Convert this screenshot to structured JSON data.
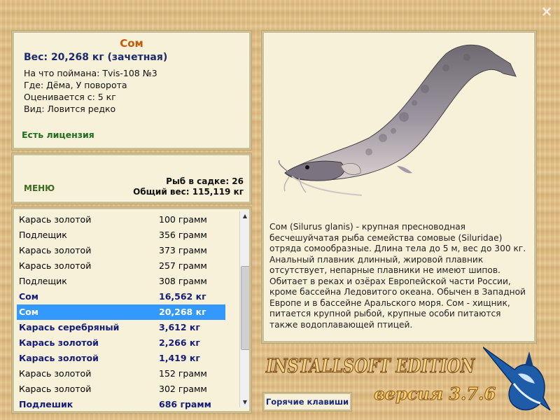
{
  "window": {
    "close_glyph": "×"
  },
  "catch_info": {
    "fish_name": "Сом",
    "weight": "Вес: 20,268 кг (зачетная)",
    "caught_on": "На что поймана: Tvis-108 №3",
    "where": "Где: Дёма, У поворота",
    "rated_from": "Оценивается с: 5 кг",
    "species_status": "Вид: Ловится редко",
    "license": "Есть лицензия"
  },
  "stats": {
    "menu_label": "МЕНЮ",
    "fish_count": "Рыб в садке: 26",
    "total_weight": "Общий вес: 115,119 кг"
  },
  "catch_list": [
    {
      "name": "Карась золотой",
      "weight": "100 грамм",
      "style": "normal"
    },
    {
      "name": "Подлещик",
      "weight": "356 грамм",
      "style": "normal"
    },
    {
      "name": "Карась золотой",
      "weight": "373 грамм",
      "style": "normal"
    },
    {
      "name": "Карась золотой",
      "weight": "257 грамм",
      "style": "normal"
    },
    {
      "name": "Подлещик",
      "weight": "308 грамм",
      "style": "normal"
    },
    {
      "name": "Сом",
      "weight": "16,562 кг",
      "style": "bold"
    },
    {
      "name": "Сом",
      "weight": "20,268 кг",
      "style": "selected"
    },
    {
      "name": "Карась серебряный",
      "weight": "3,612 кг",
      "style": "bold"
    },
    {
      "name": "Карась золотой",
      "weight": "2,266 кг",
      "style": "bold"
    },
    {
      "name": "Карась золотой",
      "weight": "1,419 кг",
      "style": "bold"
    },
    {
      "name": "Карась золотой",
      "weight": "152 грамм",
      "style": "normal"
    },
    {
      "name": "Карась золотой",
      "weight": "302 грамм",
      "style": "normal"
    },
    {
      "name": "Подлешик",
      "weight": "686 грамм",
      "style": "bold"
    }
  ],
  "description": "Сом (Silurus glanis) - крупная пресноводная бесчешуйчатая рыба семейства сомовые (Siluridae) отряда сомообразные. Длина тела до 5 м, вес до 300 кг. Анальный плавник длинный, жировой плавник отсутствует, непарные плавники не имеют шипов. Обитает в реках и озёрах Европейской части России, кроме бассейна Ледовитого океана. Обычен в Западной Европе и в бассейне Аральского моря. Сом - хищник, питается крупной рыбой, крупные особи питаются также водоплавающей птицей.",
  "footer": {
    "hotkeys_label": "Горячие клавиши",
    "brand": "INSTALLSOFT EDITION",
    "version": "версия 3.7.6"
  },
  "icons": {
    "close": "close-icon",
    "fish_image": "catfish-image",
    "logo": "marlin-logo-icon"
  }
}
